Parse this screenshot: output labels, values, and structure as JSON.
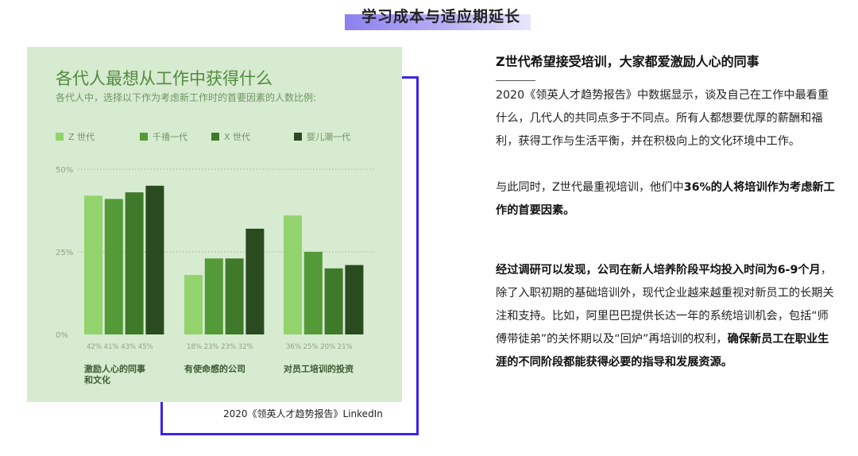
{
  "header": {
    "title": "学习成本与适应期延长"
  },
  "chart_card": {
    "title": "各代人最想从工作中获得什么",
    "subtitle": "各代人中，选择以下作为考虑新工作时的首要因素的人数比例:",
    "source": "2020《领英人才趋势报告》LinkedIn"
  },
  "colors": {
    "z": "#93d36e",
    "millennial": "#559a38",
    "x": "#3f7a2a",
    "boomer": "#2a4a20",
    "card_bg": "#d7ebd0",
    "frame": "#3d25e6",
    "header_bar": "#8c7ff0"
  },
  "chart_data": {
    "type": "bar",
    "title": "各代人最想从工作中获得什么",
    "subtitle": "各代人中，选择以下作为考虑新工作时的首要因素的人数比例:",
    "categories": [
      "激励人心的同事和文化",
      "有使命感的公司",
      "对员工培训的投资"
    ],
    "series": [
      {
        "name": "Z 世代",
        "values": [
          42,
          18,
          36
        ]
      },
      {
        "name": "千禧一代",
        "values": [
          41,
          23,
          25
        ]
      },
      {
        "name": "X 世代",
        "values": [
          43,
          23,
          20
        ]
      },
      {
        "name": "婴儿潮一代",
        "values": [
          45,
          32,
          21
        ]
      }
    ],
    "value_labels": [
      "42% 41% 43% 45%",
      "18% 23% 23% 32%",
      "36% 25% 20% 21%"
    ],
    "yticks": [
      "50%",
      "25%",
      "0%"
    ],
    "ylim": [
      0,
      50
    ],
    "grid": true,
    "legend": "top"
  },
  "right": {
    "heading": "Z世代希望接受培训，大家都爱激励人心的同事",
    "p1": "2020《领英人才趋势报告》中数据显示，谈及自己在工作中最看重什么，几代人的共同点多于不同点。所有人都想要优厚的薪酬和福利，获得工作与生活平衡，并在积极向上的文化环境中工作。",
    "p2a": "与此同时，Z世代最重视培训，他们中",
    "p2b": "36%的人将培训作为考虑新工作的首要因素。",
    "p3a": "经过调研可以发现，公司在新人培养阶段平均投入时间为6-9个月",
    "p3b": "，除了入职初期的基础培训外，现代企业越来越重视对新员工的长期关注和支持。比如，阿里巴巴提供长达一年的系统培训机会，包括“师傅带徒弟”的关怀期以及“回炉”再培训的权利，",
    "p3c": "确保新员工在职业生涯的不同阶段都能获得必要的指导和发展资源。"
  }
}
